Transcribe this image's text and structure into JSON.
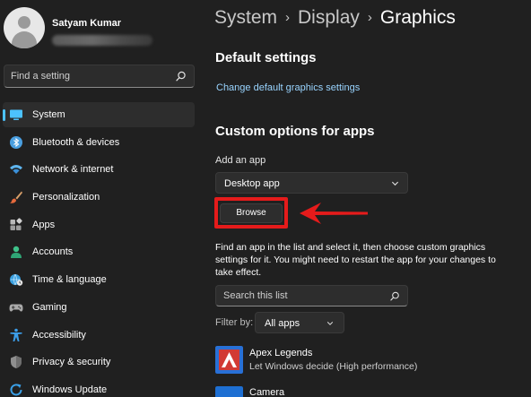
{
  "profile": {
    "name": "Satyam Kumar"
  },
  "sidebar": {
    "search_placeholder": "Find a setting",
    "items": [
      {
        "label": "System",
        "icon": "monitor-icon",
        "active": true
      },
      {
        "label": "Bluetooth & devices",
        "icon": "bluetooth-icon"
      },
      {
        "label": "Network & internet",
        "icon": "wifi-icon"
      },
      {
        "label": "Personalization",
        "icon": "brush-icon"
      },
      {
        "label": "Apps",
        "icon": "apps-icon"
      },
      {
        "label": "Accounts",
        "icon": "account-icon"
      },
      {
        "label": "Time & language",
        "icon": "globe-clock-icon"
      },
      {
        "label": "Gaming",
        "icon": "gamepad-icon"
      },
      {
        "label": "Accessibility",
        "icon": "accessibility-icon"
      },
      {
        "label": "Privacy & security",
        "icon": "shield-icon"
      },
      {
        "label": "Windows Update",
        "icon": "update-icon"
      }
    ]
  },
  "breadcrumb": {
    "part1": "System",
    "part2": "Display",
    "current": "Graphics",
    "separator": "›"
  },
  "default_settings": {
    "title": "Default settings",
    "link": "Change default graphics settings"
  },
  "custom_options": {
    "title": "Custom options for apps",
    "add_app_label": "Add an app",
    "add_app_value": "Desktop app",
    "browse_label": "Browse",
    "description": "Find an app in the list and select it, then choose custom graphics settings for it. You might need to restart the app for your changes to take effect.",
    "search_placeholder": "Search this list",
    "filter_label": "Filter by:",
    "filter_value": "All apps"
  },
  "apps": [
    {
      "name": "Apex Legends",
      "preference": "Let Windows decide (High performance)",
      "icon": "apex-legends-icon"
    },
    {
      "name": "Camera",
      "preference": "",
      "icon": "camera-icon"
    }
  ],
  "colors": {
    "accent": "#4cc2ff",
    "link": "#99d4ff",
    "highlight": "#e51b1b",
    "background": "#202020"
  }
}
